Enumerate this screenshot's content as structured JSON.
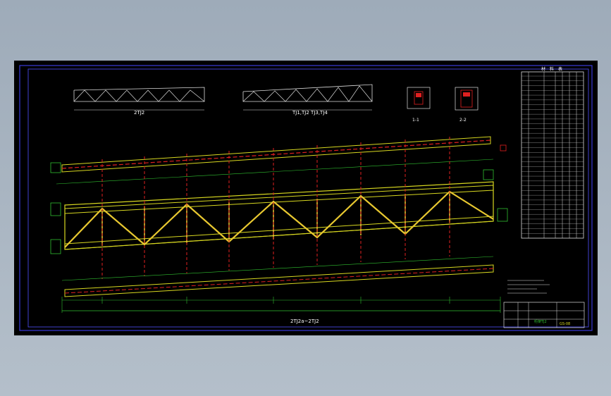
{
  "drawing": {
    "background": "#000000",
    "frame_color": "#3a3ad8",
    "chord_color": "#d8d820",
    "diagonal_color": "#e8c830",
    "axis_color": "#e02020",
    "dimension_color": "#30c030",
    "text_color": "#ffffff"
  },
  "views": {
    "truss_elevation_left": "2TJ2",
    "truss_elevation_right": "TJ1,TJ2 TJ3,TJ4",
    "section_1": "1-1",
    "section_2": "2-2",
    "main_elevation": "2TJ2a~2TJ2"
  },
  "material_table": {
    "header": [
      "材",
      "料",
      "表"
    ],
    "row_count": 34
  },
  "title_block": {
    "drawing_name": "桁架TJ2",
    "drawing_no": "GS-08"
  },
  "icons": [
    "section-symbol-icon",
    "axis-bubble-icon"
  ]
}
